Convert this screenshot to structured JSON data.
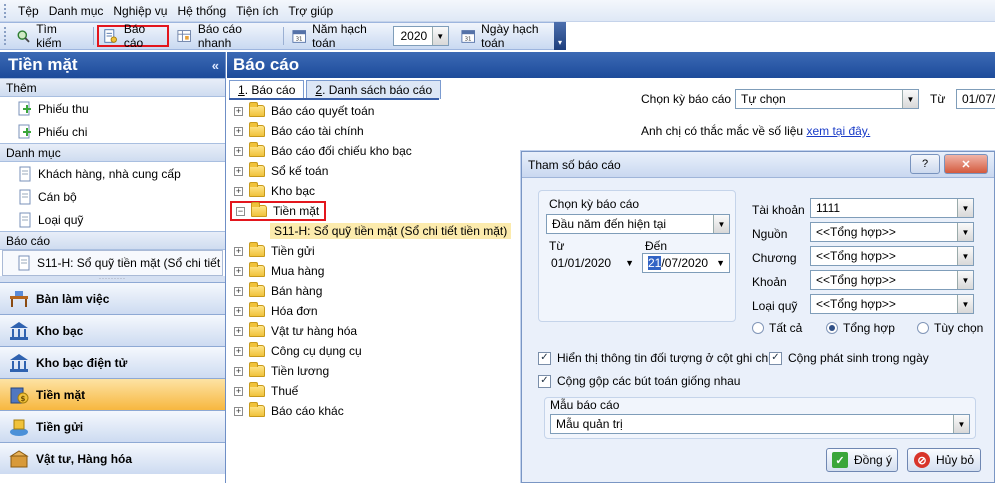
{
  "menubar": {
    "items": [
      "Tệp",
      "Danh mục",
      "Nghiệp vụ",
      "Hệ thống",
      "Tiện ích",
      "Trợ giúp"
    ]
  },
  "toolbar": {
    "search_label": "Tìm kiếm",
    "report_label": "Báo cáo",
    "quick_report_label": "Báo cáo nhanh",
    "fiscal_year_label": "Năm hạch toán",
    "fiscal_year_value": "2020",
    "posting_date_label": "Ngày hạch toán"
  },
  "left": {
    "title": "Tiền mặt",
    "groups": [
      {
        "title": "Thêm",
        "items": [
          "Phiếu thu",
          "Phiếu chi"
        ]
      },
      {
        "title": "Danh mục",
        "items": [
          "Khách hàng, nhà cung cấp",
          "Cán bộ",
          "Loại quỹ"
        ]
      },
      {
        "title": "Báo cáo",
        "items": [
          "S11-H: Sổ quỹ tiền mặt (Sổ chi tiết"
        ]
      }
    ],
    "nav": [
      "Bàn làm việc",
      "Kho bạc",
      "Kho bạc điện tử",
      "Tiền mặt",
      "Tiền gửi",
      "Vật tư, Hàng hóa"
    ]
  },
  "main": {
    "title": "Báo cáo",
    "tabs": [
      {
        "key": "1",
        "label": ". Báo cáo"
      },
      {
        "key": "2",
        "label": ". Danh sách báo cáo"
      }
    ],
    "tree": [
      "Báo cáo quyết toán",
      "Báo cáo tài chính",
      "Báo cáo đối chiếu kho bạc",
      "Sổ kế toán",
      "Kho bạc",
      "Tiền mặt",
      "Tiền gửi",
      "Mua hàng",
      "Bán hàng",
      "Hóa đơn",
      "Vật tư hàng hóa",
      "Công cụ dụng cụ",
      "Tiền lương",
      "Thuế",
      "Báo cáo khác"
    ],
    "tree_child": "S11-H: Sổ quỹ tiền mặt (Sổ chi tiết tiền mặt)",
    "period_label": "Chọn kỳ báo cáo",
    "period_value": "Tự chọn",
    "from_label": "Từ",
    "from_value": "01/07/",
    "help_text": "Anh chị có thắc mắc về số liệu",
    "help_link": "xem tại đây."
  },
  "dialog": {
    "title": "Tham số báo cáo",
    "help_btn": "?",
    "period_label": "Chọn kỳ báo cáo",
    "period_value": "Đầu năm đến hiện tại",
    "from_label": "Từ",
    "to_label": "Đến",
    "from_date": "01/01/2020",
    "to_date_sel": "21",
    "to_date_rest": "/07/2020",
    "account_label": "Tài khoản",
    "account_value": "1111",
    "source_label": "Nguồn",
    "chapter_label": "Chương",
    "item_label": "Khoản",
    "fund_label": "Loại quỹ",
    "summary_value": "<<Tổng hợp>>",
    "radio_all": "Tất cả",
    "radio_summary": "Tổng hợp",
    "radio_custom": "Tùy chọn",
    "chk_show_object": "Hiển thị thông tin đối tượng ở cột ghi chú",
    "chk_daily_total": "Cộng phát sinh trong ngày",
    "chk_merge": "Cộng gộp các bút toán giống nhau",
    "template_label": "Mẫu báo cáo",
    "template_value": "Mẫu quản trị",
    "ok_label": "Đồng ý",
    "cancel_label": "Hủy bỏ"
  },
  "colors": {
    "header_blue": "#1d4b9a",
    "highlight_red": "#e3161d",
    "active_orange": "#f7b73f"
  }
}
